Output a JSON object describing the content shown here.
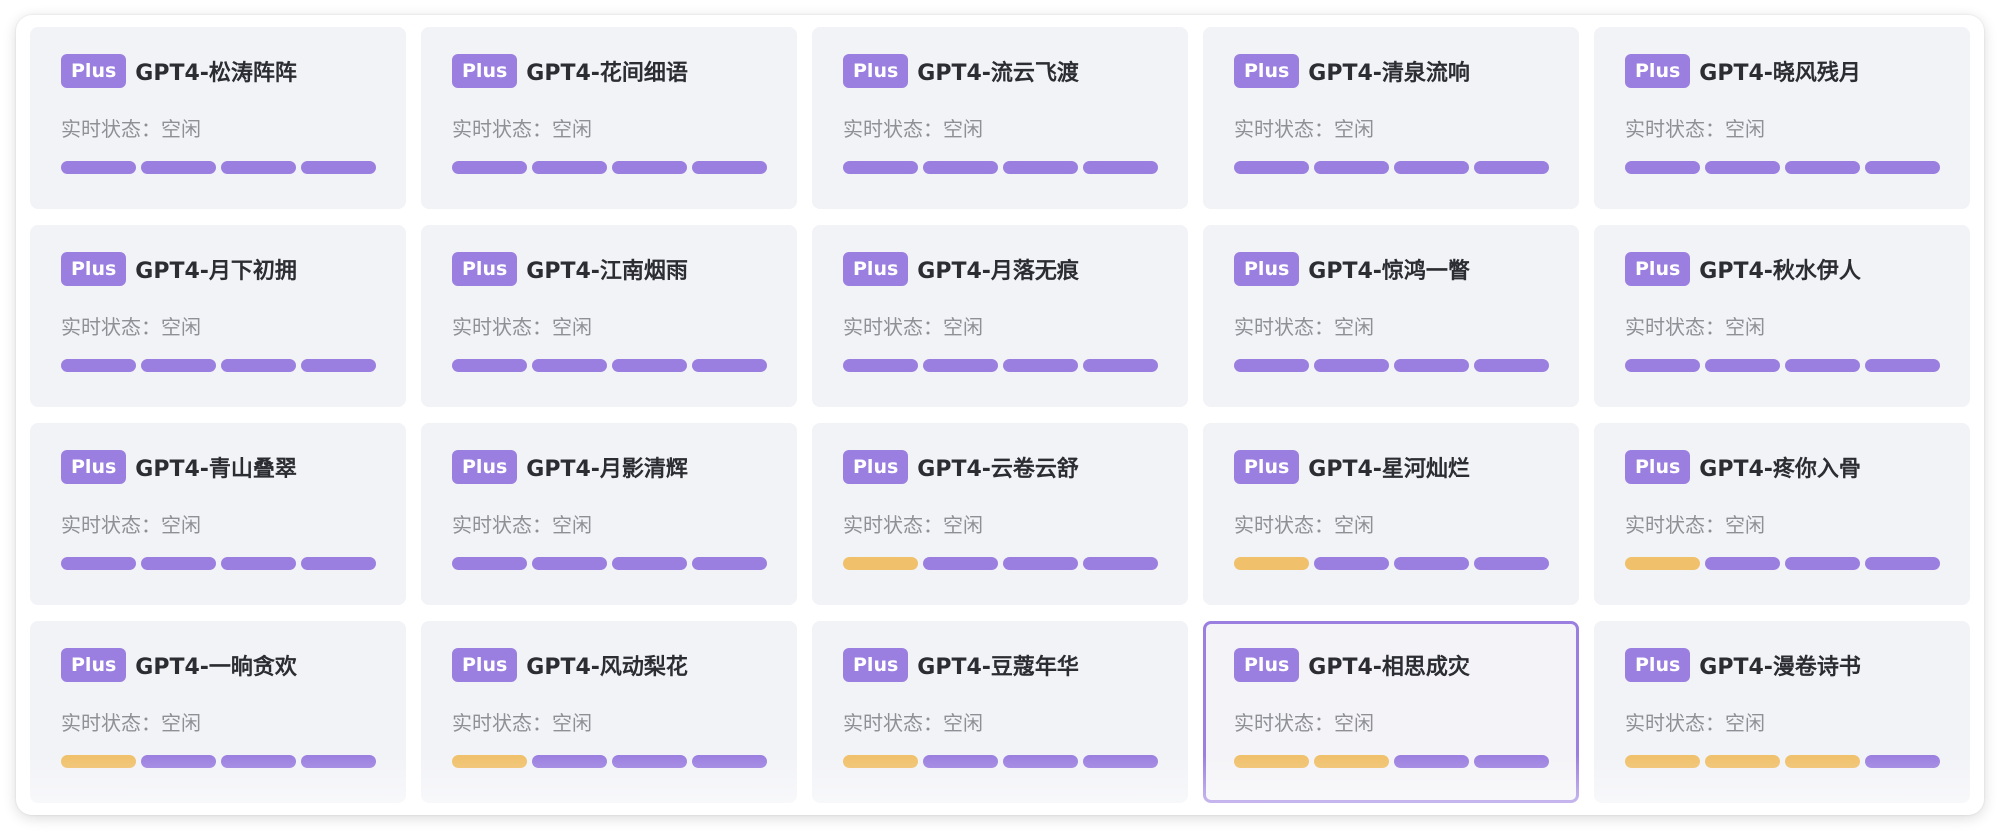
{
  "badge_label": "Plus",
  "status_label": "实时状态：",
  "colors": {
    "accent": "#9b7fe0",
    "warning": "#f0c06a",
    "card_bg": "#f2f3f7",
    "text_dark": "#2b2d33",
    "text_muted": "#8e9096"
  },
  "cards": [
    {
      "name": "GPT4-松涛阵阵",
      "status": "空闲",
      "load": [
        "normal",
        "normal",
        "normal",
        "normal"
      ],
      "selected": false
    },
    {
      "name": "GPT4-花间细语",
      "status": "空闲",
      "load": [
        "normal",
        "normal",
        "normal",
        "normal"
      ],
      "selected": false
    },
    {
      "name": "GPT4-流云飞渡",
      "status": "空闲",
      "load": [
        "normal",
        "normal",
        "normal",
        "normal"
      ],
      "selected": false
    },
    {
      "name": "GPT4-清泉流响",
      "status": "空闲",
      "load": [
        "normal",
        "normal",
        "normal",
        "normal"
      ],
      "selected": false
    },
    {
      "name": "GPT4-晓风残月",
      "status": "空闲",
      "load": [
        "normal",
        "normal",
        "normal",
        "normal"
      ],
      "selected": false
    },
    {
      "name": "GPT4-月下初拥",
      "status": "空闲",
      "load": [
        "normal",
        "normal",
        "normal",
        "normal"
      ],
      "selected": false
    },
    {
      "name": "GPT4-江南烟雨",
      "status": "空闲",
      "load": [
        "normal",
        "normal",
        "normal",
        "normal"
      ],
      "selected": false
    },
    {
      "name": "GPT4-月落无痕",
      "status": "空闲",
      "load": [
        "normal",
        "normal",
        "normal",
        "normal"
      ],
      "selected": false
    },
    {
      "name": "GPT4-惊鸿一瞥",
      "status": "空闲",
      "load": [
        "normal",
        "normal",
        "normal",
        "normal"
      ],
      "selected": false
    },
    {
      "name": "GPT4-秋水伊人",
      "status": "空闲",
      "load": [
        "normal",
        "normal",
        "normal",
        "normal"
      ],
      "selected": false
    },
    {
      "name": "GPT4-青山叠翠",
      "status": "空闲",
      "load": [
        "normal",
        "normal",
        "normal",
        "normal"
      ],
      "selected": false
    },
    {
      "name": "GPT4-月影清辉",
      "status": "空闲",
      "load": [
        "normal",
        "normal",
        "normal",
        "normal"
      ],
      "selected": false
    },
    {
      "name": "GPT4-云卷云舒",
      "status": "空闲",
      "load": [
        "warn",
        "normal",
        "normal",
        "normal"
      ],
      "selected": false
    },
    {
      "name": "GPT4-星河灿烂",
      "status": "空闲",
      "load": [
        "warn",
        "normal",
        "normal",
        "normal"
      ],
      "selected": false
    },
    {
      "name": "GPT4-疼你入骨",
      "status": "空闲",
      "load": [
        "warn",
        "normal",
        "normal",
        "normal"
      ],
      "selected": false
    },
    {
      "name": "GPT4-一晌贪欢",
      "status": "空闲",
      "load": [
        "warn",
        "normal",
        "normal",
        "normal"
      ],
      "selected": false
    },
    {
      "name": "GPT4-风动梨花",
      "status": "空闲",
      "load": [
        "warn",
        "normal",
        "normal",
        "normal"
      ],
      "selected": false
    },
    {
      "name": "GPT4-豆蔻年华",
      "status": "空闲",
      "load": [
        "warn",
        "normal",
        "normal",
        "normal"
      ],
      "selected": false
    },
    {
      "name": "GPT4-相思成灾",
      "status": "空闲",
      "load": [
        "warn",
        "warn",
        "normal",
        "normal"
      ],
      "selected": true
    },
    {
      "name": "GPT4-漫卷诗书",
      "status": "空闲",
      "load": [
        "warn",
        "warn",
        "warn",
        "normal"
      ],
      "selected": false
    }
  ]
}
